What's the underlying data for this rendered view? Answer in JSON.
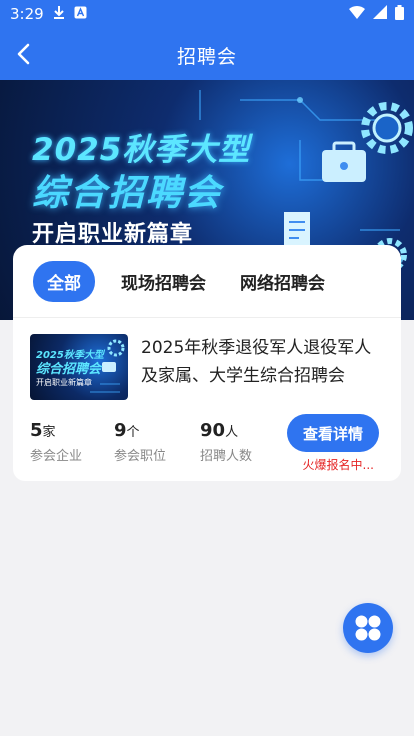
{
  "status": {
    "time": "3:29"
  },
  "header": {
    "title": "招聘会"
  },
  "banner": {
    "line1": "2025秋季大型",
    "line2": "综合招聘会",
    "line3": "开启职业新篇章"
  },
  "tabs": [
    {
      "label": "全部",
      "active": true
    },
    {
      "label": "现场招聘会",
      "active": false
    },
    {
      "label": "网络招聘会",
      "active": false
    }
  ],
  "event": {
    "thumb_line1": "2025秋季大型",
    "thumb_line2": "综合招聘会",
    "thumb_line3": "开启职业新篇章",
    "title": "2025年秋季退役军人退役军人及家属、大学生综合招聘会",
    "stats": [
      {
        "value": "5",
        "unit": "家",
        "label": "参会企业"
      },
      {
        "value": "9",
        "unit": "个",
        "label": "参会职位"
      },
      {
        "value": "90",
        "unit": "人",
        "label": "招聘人数"
      }
    ],
    "detail_button": "查看详情",
    "hot_text": "火爆报名中..."
  },
  "colors": {
    "primary": "#2f74f0",
    "hot": "#e52525",
    "background": "#f2f2f4"
  }
}
